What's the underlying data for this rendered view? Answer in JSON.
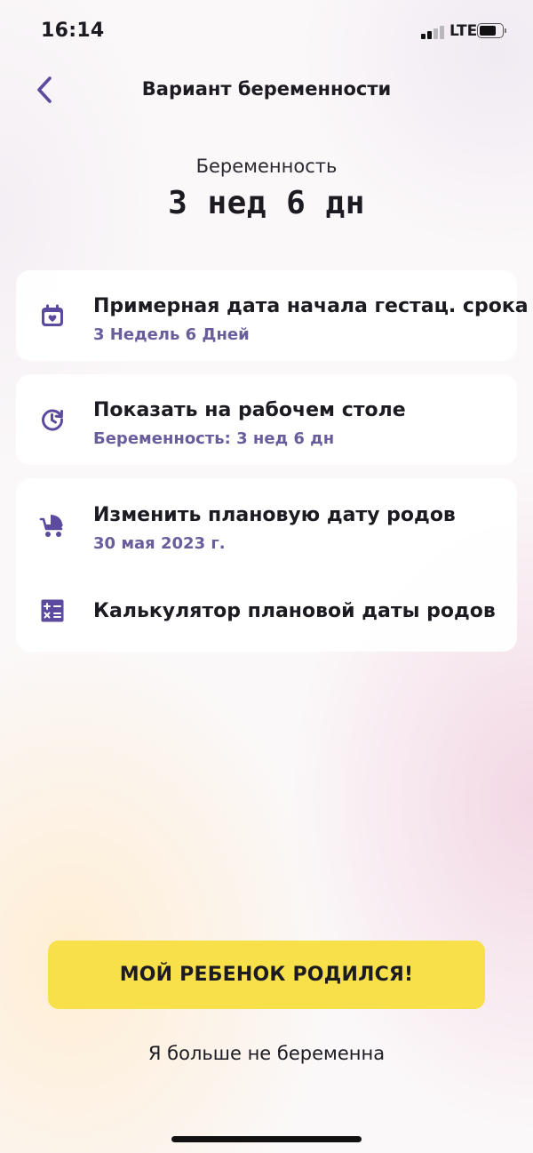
{
  "status_bar": {
    "time": "16:14",
    "network": "LTE"
  },
  "nav": {
    "back_icon": "chevron-left-icon",
    "title": "Вариант беременности"
  },
  "header": {
    "label": "Беременность",
    "value": "3 нед 6 дн"
  },
  "settings": {
    "gestation_start": {
      "icon": "calendar-heart-icon",
      "title": "Примерная дата начала гестац. срока",
      "value": "3 Недель 6 Дней"
    },
    "show_on_desktop": {
      "icon": "clock-refresh-icon",
      "title": "Показать на рабочем столе",
      "value": "Беременность: 3 нед 6 дн"
    },
    "change_due_date": {
      "icon": "stroller-icon",
      "title": "Изменить плановую дату родов",
      "value": "30 мая 2023 г."
    },
    "due_date_calculator": {
      "icon": "calculator-icon",
      "title": "Калькулятор плановой даты родов"
    }
  },
  "actions": {
    "born_button": "МОЙ РЕБЕНОК РОДИЛСЯ!",
    "not_pregnant": "Я больше не беременна"
  },
  "colors": {
    "accent": "#5b4a9e",
    "subtitle": "#6a5d9c",
    "button": "#f8e04a"
  }
}
